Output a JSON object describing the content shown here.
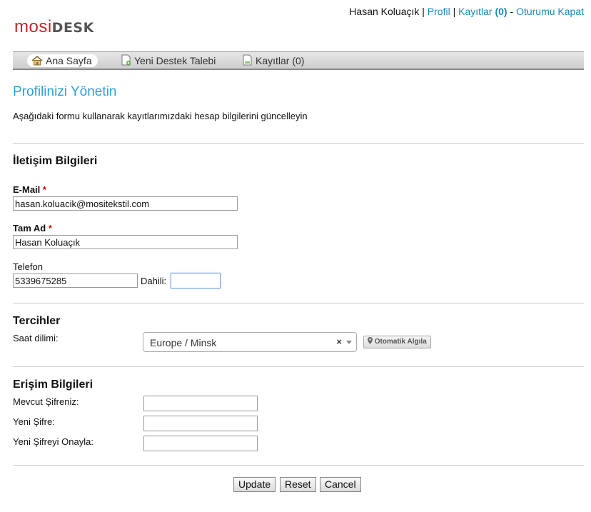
{
  "brand": {
    "part1": "mosi",
    "part2": "DESK"
  },
  "user": {
    "name": "Hasan Koluaçık",
    "sep1": " | ",
    "profile": "Profil",
    "sep2": " | ",
    "records": "Kayıtlar",
    "records_count": "(0)",
    "sep3": " - ",
    "logout": "Oturumu Kapat"
  },
  "nav": [
    {
      "label": "Ana Sayfa",
      "icon": "home-icon"
    },
    {
      "label": "Yeni Destek Talebi",
      "icon": "new-document-icon"
    },
    {
      "label": "Kayıtlar (0)",
      "icon": "document-icon"
    }
  ],
  "page": {
    "title": "Profilinizi Yönetin",
    "intro": "Aşağıdaki formu kullanarak kayıtlarımızdaki hesap bilgilerini güncelleyin"
  },
  "contact": {
    "heading": "İletişim Bilgileri",
    "email_label": "E-Mail",
    "email_value": "hasan.koluacik@mositekstil.com",
    "name_label": "Tam Ad",
    "name_value": "Hasan Koluaçık",
    "phone_label": "Telefon",
    "phone_value": "5339675285",
    "ext_label": "Dahili:",
    "ext_value": "",
    "required_mark": "*"
  },
  "prefs": {
    "heading": "Tercihler",
    "timezone_label": "Saat dilimi:",
    "timezone_value": "Europe / Minsk",
    "clear_glyph": "×",
    "autodetect_label": "Otomatik Algıla"
  },
  "access": {
    "heading": "Erişim Bilgileri",
    "current_label": "Mevcut Şifreniz:",
    "new_label": "Yeni Şifre:",
    "confirm_label": "Yeni Şifreyi Onayla:"
  },
  "buttons": {
    "update": "Update",
    "reset": "Reset",
    "cancel": "Cancel"
  },
  "colors": {
    "accent": "#29a2d8",
    "link": "#1a8ab8",
    "brand_red": "#c8232c",
    "required": "#dd0000"
  }
}
